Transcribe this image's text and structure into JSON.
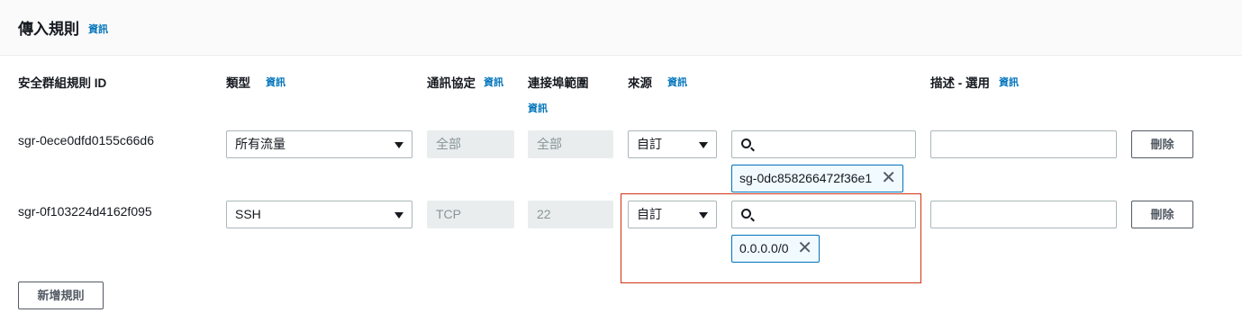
{
  "header": {
    "title": "傳入規則",
    "info": "資訊"
  },
  "columns": {
    "rule_id": "安全群組規則 ID",
    "type": "類型",
    "type_info": "資訊",
    "protocol": "通訊協定",
    "protocol_info": "資訊",
    "port_range": "連接埠範圍",
    "port_range_info": "資訊",
    "source": "來源",
    "source_info": "資訊",
    "description": "描述 - 選用",
    "description_info": "資訊"
  },
  "rules": [
    {
      "id": "sgr-0ece0dfd0155c66d6",
      "type": "所有流量",
      "protocol": "全部",
      "port_range": "全部",
      "source_type": "自訂",
      "source_search_value": "",
      "source_token": "sg-0dc858266472f36e1",
      "description": "",
      "delete_label": "刪除"
    },
    {
      "id": "sgr-0f103224d4162f095",
      "type": "SSH",
      "protocol": "TCP",
      "port_range": "22",
      "source_type": "自訂",
      "source_search_value": "",
      "source_token": "0.0.0.0/0",
      "description": "",
      "delete_label": "刪除"
    }
  ],
  "add_rule_label": "新增規則",
  "colors": {
    "link": "#0073bb",
    "highlight": "#d13212",
    "token_border": "#0073bb",
    "token_bg": "#f1faff"
  },
  "icons": {
    "search": "search-icon",
    "remove": "close-icon",
    "dropdown": "caret-down-icon"
  }
}
